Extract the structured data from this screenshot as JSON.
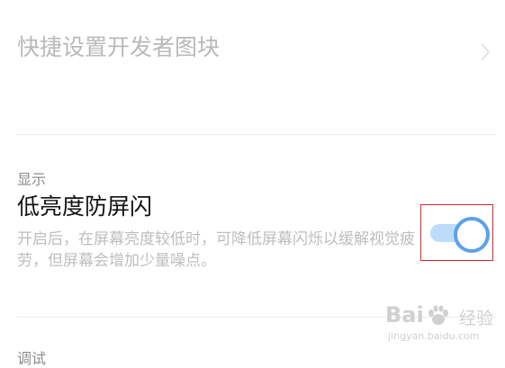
{
  "quick_settings": {
    "title": "快捷设置开发者图块",
    "chevron_icon": "chevron-right-icon"
  },
  "display_section": {
    "header": "显示",
    "setting": {
      "title": "低亮度防屏闪",
      "description": "开启后，在屏幕亮度较低时，可降低屏幕闪烁以缓解视觉疲劳，但屏幕会增加少量噪点。",
      "toggle": {
        "state": "on",
        "track_color": "#bcdcfa",
        "knob_border_color": "#5aa2ea"
      }
    }
  },
  "debug_section": {
    "header": "调试"
  },
  "highlight": {
    "color": "#d9252b"
  },
  "watermark": {
    "brand_left": "Bai",
    "brand_right": "经验",
    "site": "jingyan.baidu.com",
    "paw_icon": "baidu-paw-icon"
  }
}
